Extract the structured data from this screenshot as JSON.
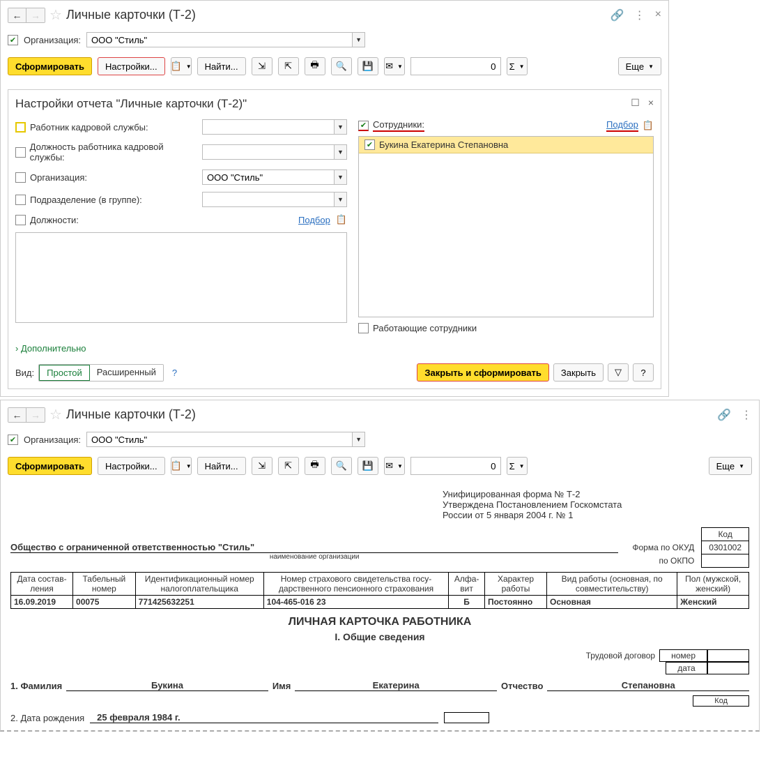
{
  "win1": {
    "title": "Личные карточки (Т-2)",
    "org_label": "Организация:",
    "org_value": "ООО \"Стиль\"",
    "generate": "Сформировать",
    "settings_btn": "Настройки...",
    "find_btn": "Найти...",
    "num_value": "0",
    "more_btn": "Еще"
  },
  "panel": {
    "title": "Настройки отчета \"Личные карточки (Т-2)\"",
    "row1": "Работник кадровой службы:",
    "row2": "Должность работника кадровой службы:",
    "row3": "Организация:",
    "row3_val": "ООО \"Стиль\"",
    "row4": "Подразделение (в группе):",
    "row5": "Должности:",
    "pick": "Подбор",
    "emp_label": "Сотрудники:",
    "emp1": "Букина Екатерина Степановна",
    "working": "Работающие сотрудники",
    "more": "Дополнительно",
    "view": "Вид:",
    "simple": "Простой",
    "ext": "Расширенный",
    "close_gen": "Закрыть и сформировать",
    "close": "Закрыть"
  },
  "win2": {
    "title": "Личные карточки (Т-2)",
    "org_label": "Организация:",
    "org_value": "ООО \"Стиль\"",
    "generate": "Сформировать",
    "settings_btn": "Настройки...",
    "find_btn": "Найти...",
    "num_value": "0",
    "more_btn": "Еще"
  },
  "doc": {
    "h1": "Унифицированная форма № Т-2",
    "h2": "Утверждена Постановлением Госкомстата",
    "h3": "России от 5 января 2004 г. № 1",
    "code_h": "Код",
    "okud_l": "Форма по ОКУД",
    "okud_v": "0301002",
    "okpo_l": "по ОКПО",
    "org": "Общество с ограниченной ответственностью \"Стиль\"",
    "org_sub": "наименование организации",
    "th1": "Дата состав­ления",
    "th2": "Табельный номер",
    "th3": "Идентифи­кационный номер налого­плательщика",
    "th4": "Номер страхового свидетельства госу­дарственного пенси­онного страхования",
    "th5": "Алфа­вит",
    "th6": "Характер работы",
    "th7": "Вид работы (основная, по совместительству)",
    "th8": "Пол (мужской, женский)",
    "td1": "16.09.2019",
    "td2": "00075",
    "td3": "771425632251",
    "td4": "104-465-016 23",
    "td5": "Б",
    "td6": "Постоянно",
    "td7": "Основная",
    "td8": "Женский",
    "card_title": "ЛИЧНАЯ КАРТОЧКА РАБОТНИКА",
    "section1": "I. Общие сведения",
    "contract_l": "Трудовой договор",
    "contract_num": "номер",
    "contract_date": "дата",
    "fam_l": "1. Фамилия",
    "fam_v": "Букина",
    "name_l": "Имя",
    "name_v": "Екатерина",
    "patr_l": "Отчество",
    "patr_v": "Степановна",
    "birth_l": "2. Дата рождения",
    "birth_v": "25 февраля 1984 г.",
    "code2": "Код"
  }
}
